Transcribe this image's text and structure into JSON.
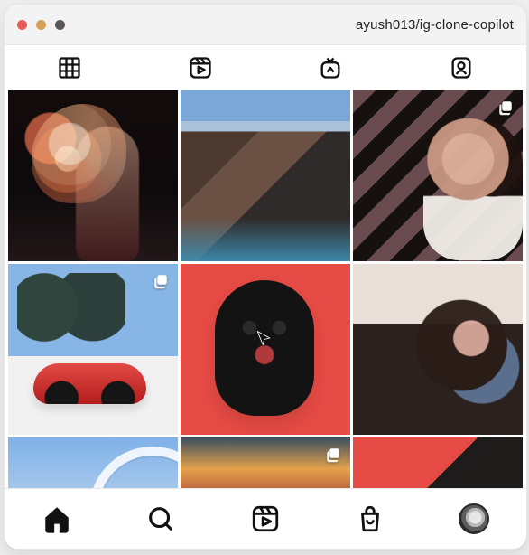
{
  "window": {
    "title": "ayush013/ig-clone-copilot",
    "traffic_lights": [
      "#e85b57",
      "#d4a05a",
      "#5b5656"
    ]
  },
  "tabs": [
    {
      "name": "grid",
      "icon": "grid-icon",
      "active": true
    },
    {
      "name": "reels",
      "icon": "reels-icon",
      "active": false
    },
    {
      "name": "igtv",
      "icon": "igtv-icon",
      "active": false
    },
    {
      "name": "tagged",
      "icon": "tagged-user-icon",
      "active": false
    }
  ],
  "grid": {
    "tiles": [
      {
        "name": "post-umbrella",
        "style": "umbrella",
        "multi": false
      },
      {
        "name": "post-mountains",
        "style": "mountains",
        "multi": false
      },
      {
        "name": "post-portrait",
        "style": "portrait",
        "multi": true
      },
      {
        "name": "post-red-car",
        "style": "car",
        "multi": true
      },
      {
        "name": "post-dog",
        "style": "dog",
        "multi": false
      },
      {
        "name": "post-curly-hair",
        "style": "curls",
        "multi": false
      },
      {
        "name": "post-ferris-wheel",
        "style": "ferris",
        "multi": false
      },
      {
        "name": "post-sunset",
        "style": "sunset",
        "multi": true
      },
      {
        "name": "post-red",
        "style": "pink",
        "multi": false
      }
    ]
  },
  "bottom_nav": [
    {
      "name": "home",
      "icon": "home-icon",
      "active": true
    },
    {
      "name": "search",
      "icon": "search-icon",
      "active": false
    },
    {
      "name": "reels",
      "icon": "reels-icon",
      "active": false
    },
    {
      "name": "shop",
      "icon": "shop-bag-icon",
      "active": false
    },
    {
      "name": "profile",
      "icon": "avatar",
      "active": false
    }
  ]
}
